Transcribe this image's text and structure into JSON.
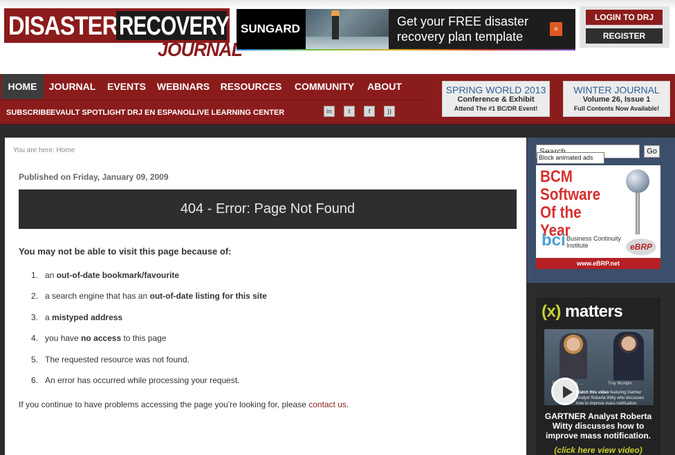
{
  "logo": {
    "word1": "DISASTER",
    "word2": "RECOVERY",
    "word3": "JOURNAL"
  },
  "banner_ad": {
    "brand": "SUNGARD",
    "headline": "Get your FREE disaster recovery plan template",
    "button_glyph": "»"
  },
  "auth": {
    "login": "LOGIN TO DRJ",
    "register": "REGISTER"
  },
  "nav": {
    "items": [
      {
        "label": "HOME",
        "active": true
      },
      {
        "label": "JOURNAL"
      },
      {
        "label": "EVENTS"
      },
      {
        "label": "WEBINARS"
      },
      {
        "label": "RESOURCES"
      },
      {
        "label": "COMMUNITY"
      },
      {
        "label": "ABOUT"
      }
    ],
    "subitems": [
      "SUBSCRIBE",
      "EVAULT SPOTLIGHT",
      "DRJ EN ESPANOL",
      "LIVE LEARNING CENTER"
    ],
    "social": [
      {
        "icon": "linkedin-icon",
        "glyph": "in"
      },
      {
        "icon": "twitter-icon",
        "glyph": "t"
      },
      {
        "icon": "facebook-icon",
        "glyph": "f"
      },
      {
        "icon": "rss-icon",
        "glyph": "))"
      }
    ]
  },
  "promos": [
    {
      "title": "SPRING WORLD 2013",
      "sub": "Conference & Exhibit",
      "tag": "Attend The #1 BC/DR Event!"
    },
    {
      "title": "WINTER JOURNAL",
      "sub": "Volume 26, Issue 1",
      "tag": "Full Contents Now Available!"
    }
  ],
  "breadcrumb": {
    "prefix": "You are here: ",
    "current": "Home"
  },
  "article": {
    "published": "Published on Friday, January 09, 2009",
    "error_title": "404 - Error: Page Not Found",
    "reason_heading": "You may not be able to visit this page because of:",
    "reasons": [
      {
        "num": "1.",
        "before": "an ",
        "bold": "out-of-date bookmark/favourite",
        "after": ""
      },
      {
        "num": "2.",
        "before": "a search engine that has an ",
        "bold": "out-of-date listing for this site",
        "after": ""
      },
      {
        "num": "3.",
        "before": "a ",
        "bold": "mistyped address",
        "after": ""
      },
      {
        "num": "4.",
        "before": "you have ",
        "bold": "no access",
        "after": " to this page"
      },
      {
        "num": "5.",
        "before": "The requested resource was not found.",
        "bold": "",
        "after": ""
      },
      {
        "num": "6.",
        "before": "An error has occurred while processing your request.",
        "bold": "",
        "after": ""
      }
    ],
    "continue_text": "If you continue to have problems accessing the page you're looking for, please ",
    "contact_link": "contact us",
    "continue_end": "."
  },
  "sidebar": {
    "search_placeholder": "Search...",
    "go": "Go",
    "block_ads": "Block animated ads",
    "bcm_ad": {
      "title": "BCM Software Of the Year",
      "logo_mark": "bci",
      "logo_text": "Business Continuity Institute",
      "ebrp": "eBRP",
      "url": "www.eBRP.net"
    },
    "xmatters_ad": {
      "logo_x": "(x)",
      "logo_rest": " matters",
      "person1": "Roberta Witty, ...",
      "person2": "Troy McAlpin",
      "watch_bold": "Watch this video",
      "watch_rest": " featuring Gartner Analyst Roberta Witty who discusses how to improve mass notification.",
      "caption": "GARTNER Analyst Roberta Witty discusses how to improve mass notification.",
      "cta": "(click here view video)"
    }
  },
  "colors": {
    "brand_red": "#8b1c1c",
    "nav_active": "#3c3c3c",
    "sidebar_blue": "#3b4f6b"
  }
}
